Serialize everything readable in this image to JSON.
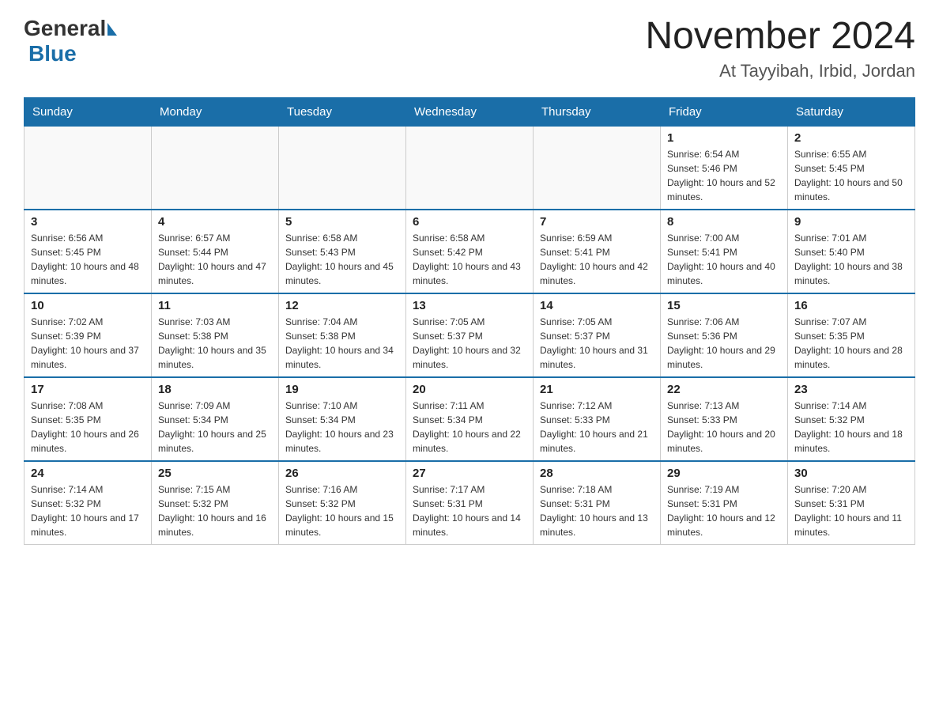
{
  "header": {
    "month_year": "November 2024",
    "location": "At Tayyibah, Irbid, Jordan"
  },
  "logo": {
    "general": "General",
    "blue": "Blue"
  },
  "weekdays": [
    "Sunday",
    "Monday",
    "Tuesday",
    "Wednesday",
    "Thursday",
    "Friday",
    "Saturday"
  ],
  "weeks": [
    {
      "days": [
        {
          "number": "",
          "info": ""
        },
        {
          "number": "",
          "info": ""
        },
        {
          "number": "",
          "info": ""
        },
        {
          "number": "",
          "info": ""
        },
        {
          "number": "",
          "info": ""
        },
        {
          "number": "1",
          "info": "Sunrise: 6:54 AM\nSunset: 5:46 PM\nDaylight: 10 hours and 52 minutes."
        },
        {
          "number": "2",
          "info": "Sunrise: 6:55 AM\nSunset: 5:45 PM\nDaylight: 10 hours and 50 minutes."
        }
      ]
    },
    {
      "days": [
        {
          "number": "3",
          "info": "Sunrise: 6:56 AM\nSunset: 5:45 PM\nDaylight: 10 hours and 48 minutes."
        },
        {
          "number": "4",
          "info": "Sunrise: 6:57 AM\nSunset: 5:44 PM\nDaylight: 10 hours and 47 minutes."
        },
        {
          "number": "5",
          "info": "Sunrise: 6:58 AM\nSunset: 5:43 PM\nDaylight: 10 hours and 45 minutes."
        },
        {
          "number": "6",
          "info": "Sunrise: 6:58 AM\nSunset: 5:42 PM\nDaylight: 10 hours and 43 minutes."
        },
        {
          "number": "7",
          "info": "Sunrise: 6:59 AM\nSunset: 5:41 PM\nDaylight: 10 hours and 42 minutes."
        },
        {
          "number": "8",
          "info": "Sunrise: 7:00 AM\nSunset: 5:41 PM\nDaylight: 10 hours and 40 minutes."
        },
        {
          "number": "9",
          "info": "Sunrise: 7:01 AM\nSunset: 5:40 PM\nDaylight: 10 hours and 38 minutes."
        }
      ]
    },
    {
      "days": [
        {
          "number": "10",
          "info": "Sunrise: 7:02 AM\nSunset: 5:39 PM\nDaylight: 10 hours and 37 minutes."
        },
        {
          "number": "11",
          "info": "Sunrise: 7:03 AM\nSunset: 5:38 PM\nDaylight: 10 hours and 35 minutes."
        },
        {
          "number": "12",
          "info": "Sunrise: 7:04 AM\nSunset: 5:38 PM\nDaylight: 10 hours and 34 minutes."
        },
        {
          "number": "13",
          "info": "Sunrise: 7:05 AM\nSunset: 5:37 PM\nDaylight: 10 hours and 32 minutes."
        },
        {
          "number": "14",
          "info": "Sunrise: 7:05 AM\nSunset: 5:37 PM\nDaylight: 10 hours and 31 minutes."
        },
        {
          "number": "15",
          "info": "Sunrise: 7:06 AM\nSunset: 5:36 PM\nDaylight: 10 hours and 29 minutes."
        },
        {
          "number": "16",
          "info": "Sunrise: 7:07 AM\nSunset: 5:35 PM\nDaylight: 10 hours and 28 minutes."
        }
      ]
    },
    {
      "days": [
        {
          "number": "17",
          "info": "Sunrise: 7:08 AM\nSunset: 5:35 PM\nDaylight: 10 hours and 26 minutes."
        },
        {
          "number": "18",
          "info": "Sunrise: 7:09 AM\nSunset: 5:34 PM\nDaylight: 10 hours and 25 minutes."
        },
        {
          "number": "19",
          "info": "Sunrise: 7:10 AM\nSunset: 5:34 PM\nDaylight: 10 hours and 23 minutes."
        },
        {
          "number": "20",
          "info": "Sunrise: 7:11 AM\nSunset: 5:34 PM\nDaylight: 10 hours and 22 minutes."
        },
        {
          "number": "21",
          "info": "Sunrise: 7:12 AM\nSunset: 5:33 PM\nDaylight: 10 hours and 21 minutes."
        },
        {
          "number": "22",
          "info": "Sunrise: 7:13 AM\nSunset: 5:33 PM\nDaylight: 10 hours and 20 minutes."
        },
        {
          "number": "23",
          "info": "Sunrise: 7:14 AM\nSunset: 5:32 PM\nDaylight: 10 hours and 18 minutes."
        }
      ]
    },
    {
      "days": [
        {
          "number": "24",
          "info": "Sunrise: 7:14 AM\nSunset: 5:32 PM\nDaylight: 10 hours and 17 minutes."
        },
        {
          "number": "25",
          "info": "Sunrise: 7:15 AM\nSunset: 5:32 PM\nDaylight: 10 hours and 16 minutes."
        },
        {
          "number": "26",
          "info": "Sunrise: 7:16 AM\nSunset: 5:32 PM\nDaylight: 10 hours and 15 minutes."
        },
        {
          "number": "27",
          "info": "Sunrise: 7:17 AM\nSunset: 5:31 PM\nDaylight: 10 hours and 14 minutes."
        },
        {
          "number": "28",
          "info": "Sunrise: 7:18 AM\nSunset: 5:31 PM\nDaylight: 10 hours and 13 minutes."
        },
        {
          "number": "29",
          "info": "Sunrise: 7:19 AM\nSunset: 5:31 PM\nDaylight: 10 hours and 12 minutes."
        },
        {
          "number": "30",
          "info": "Sunrise: 7:20 AM\nSunset: 5:31 PM\nDaylight: 10 hours and 11 minutes."
        }
      ]
    }
  ]
}
